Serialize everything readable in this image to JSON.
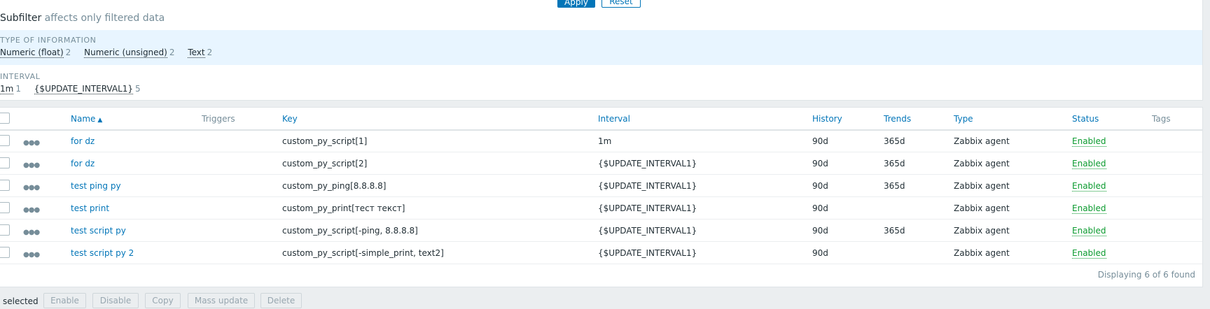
{
  "filter": {
    "apply_label": "Apply",
    "reset_label": "Reset",
    "subfilter_title": "Subfilter",
    "subfilter_hint": "affects only filtered data",
    "type_of_information": {
      "label": "TYPE OF INFORMATION",
      "items": [
        {
          "label": "Numeric (float)",
          "count": "2"
        },
        {
          "label": "Numeric (unsigned)",
          "count": "2"
        },
        {
          "label": "Text",
          "count": "2"
        }
      ]
    },
    "interval": {
      "label": "INTERVAL",
      "items": [
        {
          "label": "1m",
          "count": "1"
        },
        {
          "label": "{$UPDATE_INTERVAL1}",
          "count": "5"
        }
      ]
    }
  },
  "table": {
    "headers": {
      "name": "Name",
      "triggers": "Triggers",
      "key": "Key",
      "interval": "Interval",
      "history": "History",
      "trends": "Trends",
      "type": "Type",
      "status": "Status",
      "tags": "Tags"
    },
    "rows": [
      {
        "name": "for dz",
        "key": "custom_py_script[1]",
        "interval": "1m",
        "history": "90d",
        "trends": "365d",
        "type": "Zabbix agent",
        "status": "Enabled"
      },
      {
        "name": "for dz",
        "key": "custom_py_script[2]",
        "interval": "{$UPDATE_INTERVAL1}",
        "history": "90d",
        "trends": "365d",
        "type": "Zabbix agent",
        "status": "Enabled"
      },
      {
        "name": "test ping py",
        "key": "custom_py_ping[8.8.8.8]",
        "interval": "{$UPDATE_INTERVAL1}",
        "history": "90d",
        "trends": "365d",
        "type": "Zabbix agent",
        "status": "Enabled"
      },
      {
        "name": "test print",
        "key": "custom_py_print[тест текст]",
        "interval": "{$UPDATE_INTERVAL1}",
        "history": "90d",
        "trends": "",
        "type": "Zabbix agent",
        "status": "Enabled"
      },
      {
        "name": "test script py",
        "key": "custom_py_script[-ping, 8.8.8.8]",
        "interval": "{$UPDATE_INTERVAL1}",
        "history": "90d",
        "trends": "365d",
        "type": "Zabbix agent",
        "status": "Enabled"
      },
      {
        "name": "test script py 2",
        "key": "custom_py_script[-simple_print, text2]",
        "interval": "{$UPDATE_INTERVAL1}",
        "history": "90d",
        "trends": "",
        "type": "Zabbix agent",
        "status": "Enabled"
      }
    ],
    "footer": "Displaying 6 of 6 found",
    "row_menu_icon": "more-dots-icon"
  },
  "actions": {
    "selected_text": "selected",
    "buttons": [
      "Enable",
      "Disable",
      "Copy",
      "Mass update",
      "Delete"
    ]
  },
  "colors": {
    "link": "#0275b8",
    "status_enabled": "#0a9a2e",
    "subfilter_highlight": "#e8f5ff",
    "page_background": "#ebeef0"
  }
}
